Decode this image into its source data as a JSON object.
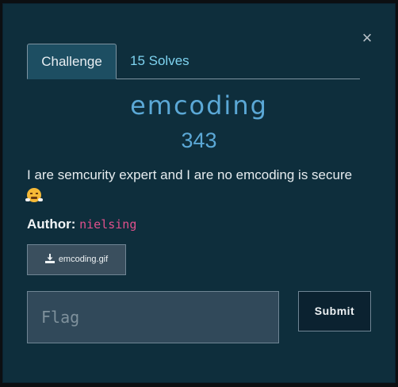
{
  "modal": {
    "close_glyph": "×"
  },
  "tabs": [
    {
      "label": "Challenge"
    },
    {
      "label": "15 Solves"
    }
  ],
  "challenge": {
    "name": "emcoding",
    "points": "343",
    "description": "I are semcurity expert and I are no emcoding is secure",
    "description_emoji": "face-with-steam-from-nose-icon",
    "author_label": "Author:",
    "author_name": "nielsing",
    "file_name": "emcoding.gif",
    "file_icon": "download-icon"
  },
  "form": {
    "flag_placeholder": "Flag",
    "flag_value": "",
    "submit_label": "Submit"
  },
  "colors": {
    "modal_bg": "#0e2e3c",
    "accent": "#5ba8d6",
    "solves_link": "#7ed3f0",
    "author_name": "#e0508c"
  }
}
